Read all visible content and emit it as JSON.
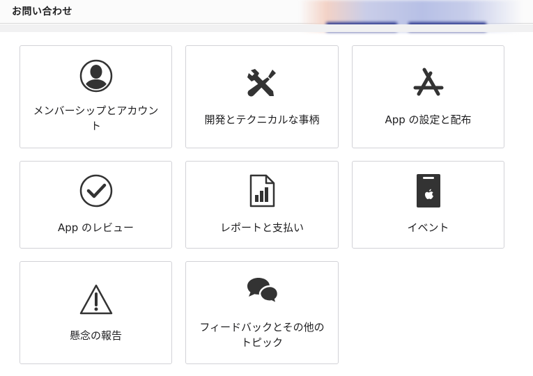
{
  "header": {
    "title": "お問い合わせ"
  },
  "topics": [
    {
      "label": "メンバーシップとアカウント",
      "icon": "member-avatar-icon"
    },
    {
      "label": "開発とテクニカルな事柄",
      "icon": "tools-icon"
    },
    {
      "label": "App の設定と配布",
      "icon": "app-store-icon"
    },
    {
      "label": "App のレビュー",
      "icon": "checkmark-icon"
    },
    {
      "label": "レポートと支払い",
      "icon": "report-chart-icon"
    },
    {
      "label": "イベント",
      "icon": "event-badge-icon"
    },
    {
      "label": "懸念の報告",
      "icon": "warning-icon"
    },
    {
      "label": "フィードバックとその他のトピック",
      "icon": "chat-bubbles-icon"
    }
  ],
  "colors": {
    "icon": "#333333",
    "card_border": "#d2d2d7",
    "text": "#1d1d1f"
  }
}
